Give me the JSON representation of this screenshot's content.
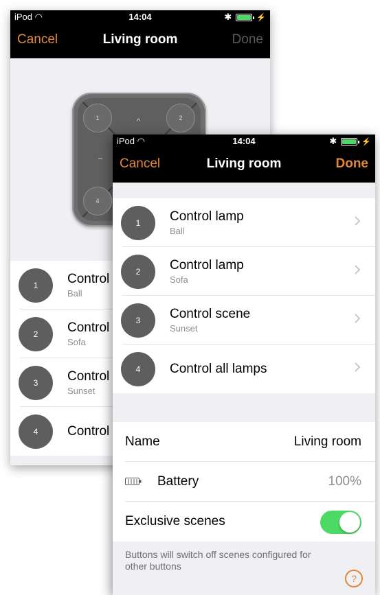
{
  "status": {
    "carrier": "iPod",
    "time": "14:04"
  },
  "back_screen": {
    "nav": {
      "cancel": "Cancel",
      "title": "Living room",
      "done": "Done"
    },
    "remote_buttons": [
      "1",
      "2",
      "4"
    ],
    "remote_marks": [
      "^",
      "–"
    ],
    "rows": [
      {
        "num": "1",
        "title": "Control",
        "sub": "Ball"
      },
      {
        "num": "2",
        "title": "Control",
        "sub": "Sofa"
      },
      {
        "num": "3",
        "title": "Control",
        "sub": "Sunset"
      },
      {
        "num": "4",
        "title": "Control",
        "sub": ""
      }
    ]
  },
  "front_screen": {
    "nav": {
      "cancel": "Cancel",
      "title": "Living room",
      "done": "Done"
    },
    "rows": [
      {
        "num": "1",
        "title": "Control lamp",
        "sub": "Ball"
      },
      {
        "num": "2",
        "title": "Control lamp",
        "sub": "Sofa"
      },
      {
        "num": "3",
        "title": "Control scene",
        "sub": "Sunset"
      },
      {
        "num": "4",
        "title": "Control all lamps",
        "sub": ""
      }
    ],
    "settings": {
      "name_label": "Name",
      "name_value": "Living room",
      "battery_label": "Battery",
      "battery_value": "100%",
      "exclusive_label": "Exclusive scenes",
      "exclusive_on": true
    },
    "footer": "Buttons will switch off scenes configured for other buttons",
    "help": "?"
  },
  "colors": {
    "accent": "#e1883a",
    "toggle_on": "#4cd964",
    "circle": "#5e5e5e"
  },
  "icons": [
    "wifi-icon",
    "bluetooth-icon",
    "battery-icon",
    "chevron-right-icon",
    "help-icon"
  ]
}
